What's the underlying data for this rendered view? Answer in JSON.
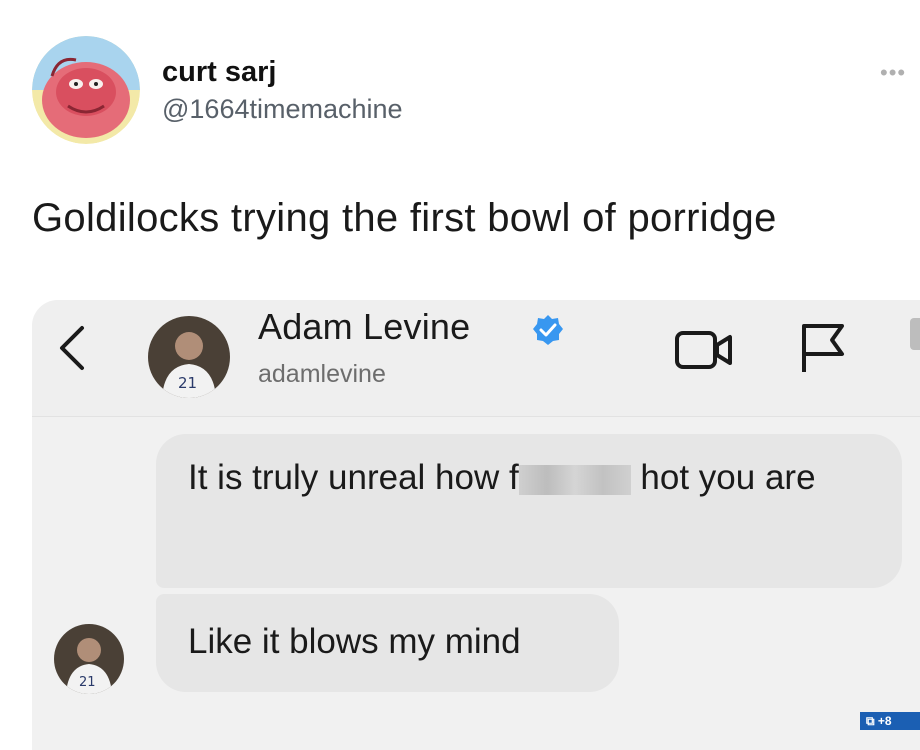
{
  "tweet": {
    "display_name": "curt sarj",
    "handle": "@1664timemachine",
    "more_icon": "more-horizontal-icon",
    "text": "Goldilocks trying the first bowl of porridge"
  },
  "dm": {
    "contact_name": "Adam Levine",
    "username": "adamlevine",
    "verified": true,
    "accent_color": "#3897f0",
    "icons": [
      "back-chevron-icon",
      "video-call-icon",
      "report-flag-icon",
      "verified-badge-icon"
    ],
    "messages": [
      {
        "text_before": "It is truly unreal how f",
        "text_after": " hot you are",
        "censored": true
      },
      {
        "text": "Like it blows my mind"
      }
    ]
  },
  "watermark": {
    "text": "+8"
  }
}
